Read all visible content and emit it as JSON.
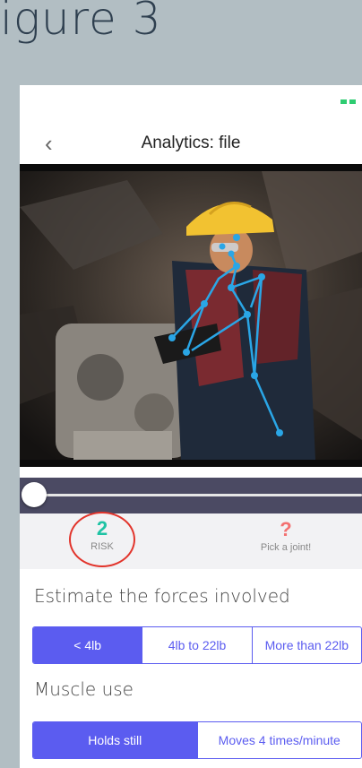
{
  "figure": {
    "title": "igure 3"
  },
  "nav": {
    "title": "Analytics: file",
    "back_glyph": "‹"
  },
  "metrics": {
    "risk_value": "2",
    "risk_label": "RISK",
    "joint_mark": "?",
    "joint_label": "Pick a joint!"
  },
  "forces": {
    "title": "Estimate the forces involved",
    "options": [
      "< 4lb",
      "4lb to 22lb",
      "More than 22lb"
    ],
    "selected": "< 4lb"
  },
  "muscle": {
    "title": "Muscle use",
    "options": [
      "Holds still",
      "Moves 4 times/minute"
    ],
    "selected": "Holds still"
  },
  "video": {
    "progress": 0.0
  },
  "colors": {
    "accent": "#5b5cf0",
    "risk": "#1fc3a4",
    "joint": "#f37070",
    "highlight": "#e2342b",
    "skeleton": "#2aa6e6"
  }
}
